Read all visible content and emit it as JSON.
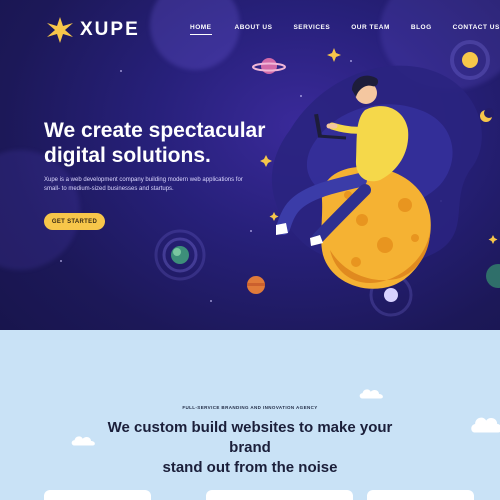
{
  "brand": {
    "name": "XUPE",
    "star_color": "#f7c64a"
  },
  "nav": {
    "items": [
      {
        "label": "HOME",
        "active": true
      },
      {
        "label": "ABOUT US",
        "active": false
      },
      {
        "label": "SERVICES",
        "active": false
      },
      {
        "label": "OUR TEAM",
        "active": false
      },
      {
        "label": "BLOG",
        "active": false
      },
      {
        "label": "CONTACT US",
        "active": false
      }
    ]
  },
  "hero": {
    "title_line1": "We create spectacular",
    "title_line2": "digital solutions.",
    "description": "Xupe is a web development company building modern web applications for small- to medium-sized businesses and startups.",
    "cta_label": "GET STARTED",
    "bg_color": "#1f1a5e",
    "accent_color": "#f7c64a"
  },
  "section": {
    "kicker": "FULL-SERVICE BRANDING AND INNOVATION AGENCY",
    "title_line1": "We custom build websites to make your brand",
    "title_line2": "stand out from the noise",
    "bg_color": "#c9e2f6"
  }
}
